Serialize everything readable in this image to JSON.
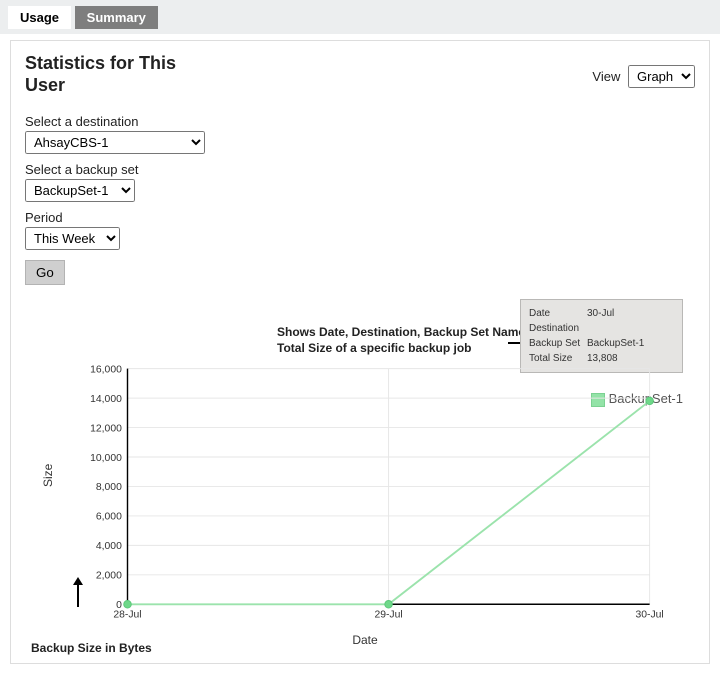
{
  "tabs": {
    "usage": "Usage",
    "summary": "Summary"
  },
  "title": "Statistics for This User",
  "viewLabel": "View",
  "viewValue": "Graph",
  "dest": {
    "label": "Select a destination",
    "value": "AhsayCBS-1"
  },
  "bset": {
    "label": "Select a backup set",
    "value": "BackupSet-1"
  },
  "period": {
    "label": "Period",
    "value": "This Week"
  },
  "goLabel": "Go",
  "hint": "Shows Date, Destination, Backup Set Name and Total Size of a specific backup job",
  "tooltip": {
    "dateL": "Date",
    "dateV": "30-Jul",
    "destL": "Destination",
    "destV": "",
    "setL": "Backup Set",
    "setV": "BackupSet-1",
    "sizeL": "Total Size",
    "sizeV": "13,808"
  },
  "legend": "BackupSet-1",
  "chart_data": {
    "type": "line",
    "categories": [
      "28-Jul",
      "29-Jul",
      "30-Jul"
    ],
    "values": [
      0,
      0,
      13808
    ],
    "xlabel": "Date",
    "ylabel": "Size",
    "ylim": [
      0,
      16000
    ],
    "yticks": [
      0,
      2000,
      4000,
      6000,
      8000,
      10000,
      12000,
      14000,
      16000
    ],
    "ytickLabels": [
      "0",
      "2,000",
      "4,000",
      "6,000",
      "8,000",
      "10,000",
      "12,000",
      "14,000",
      "16,000"
    ]
  },
  "bnote": "Backup Size in Bytes"
}
